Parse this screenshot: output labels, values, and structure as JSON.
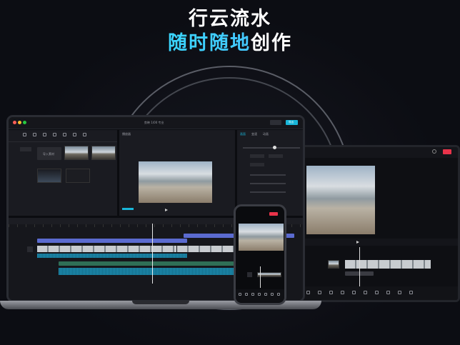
{
  "headline": {
    "line1": "行云流水",
    "line2_highlight": "随时随地",
    "line2_tail": "创作"
  },
  "colors": {
    "highlight_gradient": [
      "#3ad6ff",
      "#44c8ff"
    ],
    "export_button": "#19b6d9",
    "tablet_export": "#e8334a",
    "timeline_video": "#5b6bd0",
    "timeline_audio": "#1d8fb3"
  },
  "laptop": {
    "app_title": "剪映 1/00 专业",
    "toolbar_icons": [
      "media-icon",
      "audio-icon",
      "text-icon",
      "sticker-icon",
      "effects-icon",
      "transition-icon",
      "filter-icon"
    ],
    "media_import_label": "导入素材",
    "player_title": "播放器",
    "inspector_tabs": [
      "画面",
      "变速",
      "动画"
    ],
    "export_label": "导出"
  },
  "tablet": {
    "export_label": "导出"
  },
  "phone": {
    "export_label": "导出"
  }
}
